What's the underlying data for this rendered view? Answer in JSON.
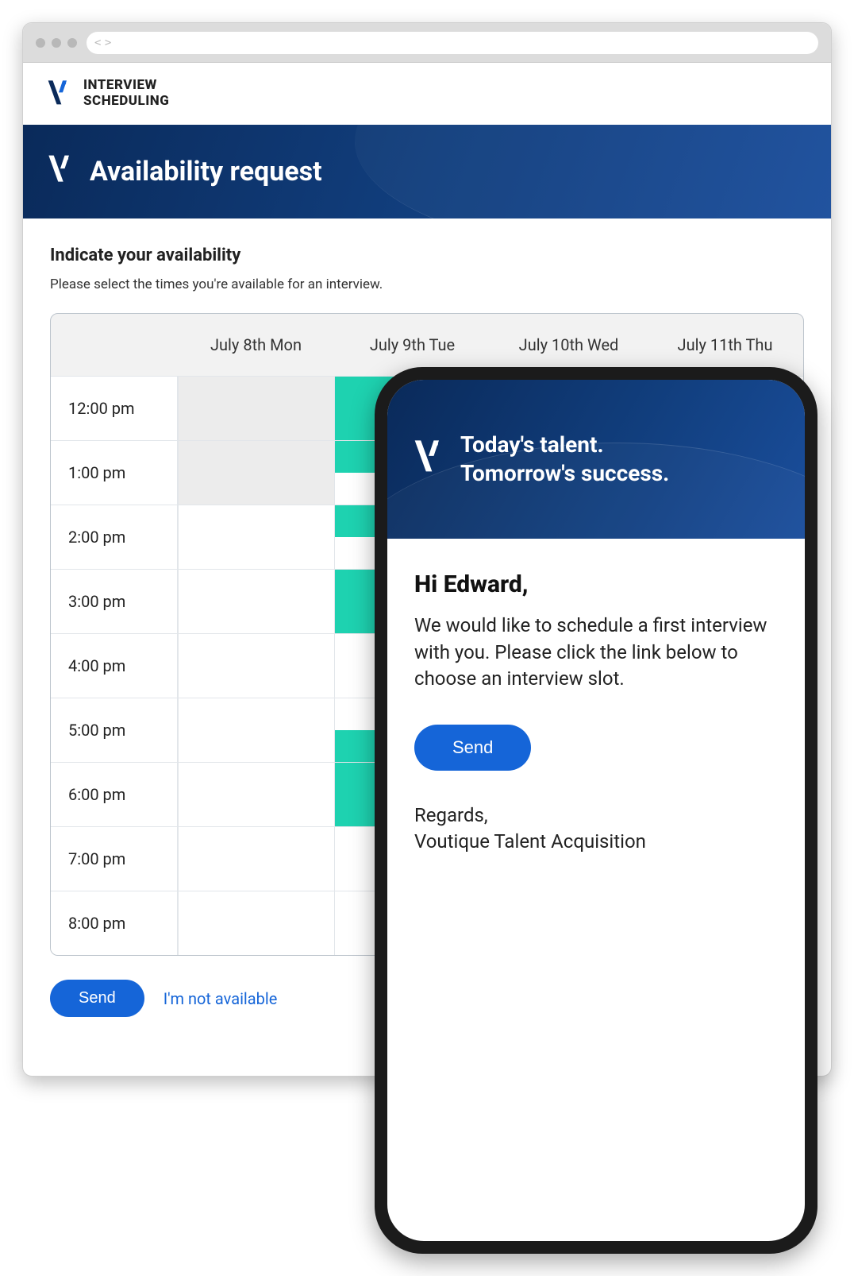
{
  "browser": {
    "app_title_line1": "INTERVIEW",
    "app_title_line2": "SCHEDULING"
  },
  "banner": {
    "title": "Availability request"
  },
  "section": {
    "heading": "Indicate your availability",
    "sub": "Please select the times you're available for an interview."
  },
  "calendar": {
    "days": [
      "July 8th Mon",
      "July 9th Tue",
      "July 10th Wed",
      "July 11th Thu"
    ],
    "times": [
      "12:00 pm",
      "1:00 pm",
      "2:00 pm",
      "3:00 pm",
      "4:00 pm",
      "5:00 pm",
      "6:00 pm",
      "7:00 pm",
      "8:00 pm"
    ]
  },
  "actions": {
    "send": "Send",
    "not_available": "I'm not available"
  },
  "phone": {
    "tagline_line1": "Today's talent.",
    "tagline_line2": "Tomorrow's success.",
    "greeting": "Hi Edward,",
    "body": "We would like to schedule a first interview with you. Please click the link below to choose an interview slot.",
    "send": "Send",
    "closing": "Regards,",
    "sender": "Voutique Talent Acquisition"
  },
  "colors": {
    "accent_blue": "#1565d8",
    "teal": "#1ed2b0",
    "banner_navy": "#113e7d"
  }
}
